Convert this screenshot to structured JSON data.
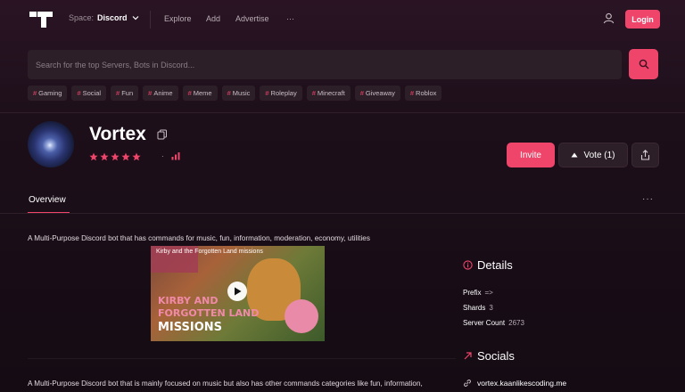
{
  "header": {
    "space_label": "Space:",
    "space_value": "Discord",
    "nav": [
      "Explore",
      "Add",
      "Advertise",
      "···"
    ],
    "login_label": "Login"
  },
  "search": {
    "placeholder": "Search for the top Servers, Bots in Discord..."
  },
  "tags": [
    "Gaming",
    "Social",
    "Fun",
    "Anime",
    "Meme",
    "Music",
    "Roleplay",
    "Minecraft",
    "Giveaway",
    "Roblox"
  ],
  "bot": {
    "name": "Vortex",
    "rating_stars": 5,
    "rating_separator": "·"
  },
  "actions": {
    "invite_label": "Invite",
    "vote_label": "Vote (1)"
  },
  "tabs": {
    "overview_label": "Overview",
    "more_label": "···"
  },
  "content": {
    "description_short": "A Multi-Purpose Discord bot that has commands for music, fun, information, moderation, economy, utilities",
    "video_title": "Kirby and the Forgotten Land missions",
    "video_text_line1": "KIRBY AND",
    "video_text_line2": "FORGOTTEN LAND",
    "video_text_line3": "MISSIONS",
    "description_long": "A Multi-Purpose Discord bot that is mainly focused on music but also has other commands categories like fun, information, moderation, economy, utilities, there will be a lot of new stuff coming soon, dashboard will be coming in the"
  },
  "details": {
    "heading": "Details",
    "prefix_label": "Prefix",
    "prefix_value": "=>",
    "shards_label": "Shards",
    "shards_value": "3",
    "server_count_label": "Server Count",
    "server_count_value": "2673"
  },
  "socials": {
    "heading": "Socials",
    "link": "vortex.kaanlikescoding.me"
  },
  "colors": {
    "accent": "#f0456a",
    "background": "#1d0f1a",
    "surface": "#2c1f28"
  }
}
